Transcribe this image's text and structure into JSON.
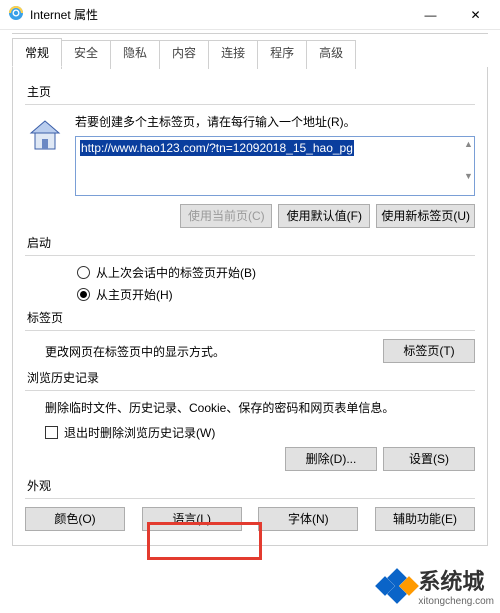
{
  "window": {
    "title": "Internet 属性",
    "minimize": "—",
    "close": "✕"
  },
  "tabs": {
    "general": "常规",
    "security": "安全",
    "privacy": "隐私",
    "content": "内容",
    "connections": "连接",
    "programs": "程序",
    "advanced": "高级",
    "active": "general"
  },
  "homepage": {
    "label": "主页",
    "hint": "若要创建多个主标签页，请在每行输入一个地址(R)。",
    "url": "http://www.hao123.com/?tn=12092018_15_hao_pg",
    "use_current": "使用当前页(C)",
    "use_default": "使用默认值(F)",
    "use_newtab": "使用新标签页(U)"
  },
  "startup": {
    "label": "启动",
    "opt_last": "从上次会话中的标签页开始(B)",
    "opt_home": "从主页开始(H)",
    "selected": "home"
  },
  "tabs_section": {
    "label": "标签页",
    "hint": "更改网页在标签页中的显示方式。",
    "button": "标签页(T)"
  },
  "history": {
    "label": "浏览历史记录",
    "hint": "删除临时文件、历史记录、Cookie、保存的密码和网页表单信息。",
    "check_label": "退出时删除浏览历史记录(W)",
    "checked": false,
    "delete_btn": "删除(D)...",
    "settings_btn": "设置(S)"
  },
  "appearance": {
    "label": "外观",
    "colors": "颜色(O)",
    "language": "语言(L)",
    "fonts": "字体(N)",
    "accessibility": "辅助功能(E)"
  },
  "watermark": {
    "brand": "系统城",
    "url": "xitongcheng.com"
  }
}
